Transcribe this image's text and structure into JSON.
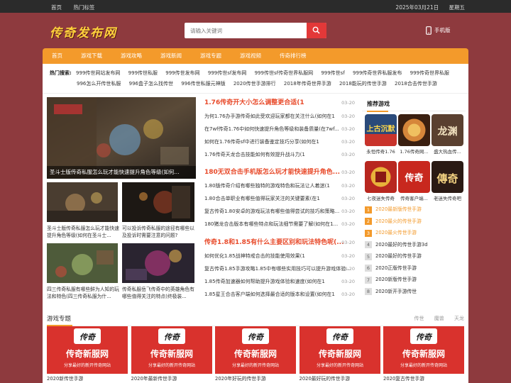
{
  "topbar": {
    "links": [
      "首页",
      "热门标签"
    ],
    "date": "2025年03月21日",
    "weekday": "星期五"
  },
  "header": {
    "logo_text": "传奇发布网",
    "search_placeholder": "请输入关键词",
    "mobile_label": "手机版"
  },
  "nav": [
    "首页",
    "游戏下载",
    "游戏攻略",
    "游戏新闻",
    "游戏专题",
    "游戏视频",
    "传奇排行榜"
  ],
  "hot": {
    "label": "热门搜索:",
    "row1": [
      "999传世网站发布网",
      "999传世私服",
      "999传世发布网",
      "999传世sf发布网",
      "999传世sf传奇世界私服网",
      "999传世sf",
      "999传奇世界私服发布",
      "999传奇世界私服"
    ],
    "row2": [
      "996怎么开传世私服",
      "996盒子怎么找传世",
      "996传世私服元神版",
      "2020传世手游排行",
      "2018年传奇世界手游",
      "2018能玩的传世手游",
      "2018合击传世手游"
    ]
  },
  "slider": {
    "caption": "圣斗士版传奇私服怎么玩才能快速提升角色等级(如何..."
  },
  "thumbs": [
    {
      "caption": "圣斗士版传奇私服怎么玩才能快速提升角色等级(如何在圣斗士..."
    },
    {
      "caption": "可以投诉传奇私服的途径有哪些以及投诉时需要注意的问题?"
    },
    {
      "caption": "四三传奇私服有哪些鲜为人知的玩法和特色(四三传奇私服为什..."
    },
    {
      "caption": "传奇私服岳飞传奇中的英雄角色有哪些值得关注的特点(终极装..."
    }
  ],
  "news": [
    {
      "lead": "1.76传奇开大小怎么调整更合适(1",
      "lead_date": "03-20",
      "items": [
        {
          "t": "为何1.76办手游传奇如此受欢迎玩家都在关注什么(如何在1",
          "d": "03-20"
        },
        {
          "t": "在7wf传奇1.76中如何快速提升角色等级和装备质量(在7wf...",
          "d": "03-20"
        },
        {
          "t": "如何在1.76传奇sf中进行装备鉴定技巧分享(如何在1",
          "d": "03-20"
        },
        {
          "t": "1.76传奇天龙合击技能如何有效提升战斗力(1",
          "d": "03-20"
        }
      ]
    },
    {
      "lead": "180无双合击手机版怎么玩才能快速提升角色...",
      "lead_date": "03-20",
      "items": [
        {
          "t": "1.80版传奇介绍有哪些独特的游戏特色和玩法让人着迷(1",
          "d": "03-20"
        },
        {
          "t": "1.80合击单职业有哪些值得玩家关注的关键要素(在1",
          "d": "03-20"
        },
        {
          "t": "复古传奇1.80安卓的游戏玩法有哪些值得尝试的技巧和策略...",
          "d": "03-20"
        },
        {
          "t": "180猪龙合击版本有哪些特点和玩法细节需要了解(如何在1...",
          "d": "03-20"
        }
      ]
    },
    {
      "lead": "传奇1.8和1.85有什么主要区别和玩法特色呢(...",
      "lead_date": "03-20",
      "items": [
        {
          "t": "如何优化1.85战神特戒合击的技能使用效果(1",
          "d": "03-20"
        },
        {
          "t": "复古传奇1.85手游攻略1.85中有哪些实用技巧可以提升游戏体验...",
          "d": "03-20"
        },
        {
          "t": "1.85传奇加速器如何帮助提升游戏体验和速度(如何在1",
          "d": "03-20"
        },
        {
          "t": "1.85星王合击客户端如何选择最合适的版本和设置(如何在1",
          "d": "03-20"
        }
      ]
    }
  ],
  "sidebar": {
    "title": "推荐游戏",
    "games": [
      "永恒传奇1.76",
      "1.76传奇网...",
      "盛大热血传...",
      "七夜迷失传奇",
      "传奇客户端...",
      "老迷失传奇吧"
    ],
    "game_icon_texts": [
      "上古沉默",
      "",
      "龙渊",
      "",
      "传奇",
      "傳奇"
    ],
    "rank": [
      {
        "n": "1",
        "t": "2020最新版传世手游"
      },
      {
        "n": "2",
        "t": "2020最火的传世手游"
      },
      {
        "n": "3",
        "t": "2020最火传世手游"
      },
      {
        "n": "4",
        "t": "2020最好的传世手游3d"
      },
      {
        "n": "5",
        "t": "2020最好的传世手游"
      },
      {
        "n": "6",
        "t": "2020正版传世手游"
      },
      {
        "n": "7",
        "t": "2020新版传世手游"
      },
      {
        "n": "8",
        "t": "2020新开手游传世"
      }
    ]
  },
  "topics": {
    "title": "游戏专题",
    "tags": [
      "传世",
      "魔兽",
      "天龙"
    ],
    "card_brand": "传奇新服网",
    "card_sub": "分享最好的新开传奇网站",
    "card_badge": "传奇",
    "cards": [
      "2020新传世手游",
      "2020年最新传世手游",
      "2020年好玩的传世手游",
      "2020最好玩的传世手游",
      "2020复古传世手游"
    ]
  },
  "colors": {
    "background": "#8e3a3e",
    "accent": "#f39a2b",
    "search_button": "#e33838",
    "logo": "#ffd23c"
  }
}
